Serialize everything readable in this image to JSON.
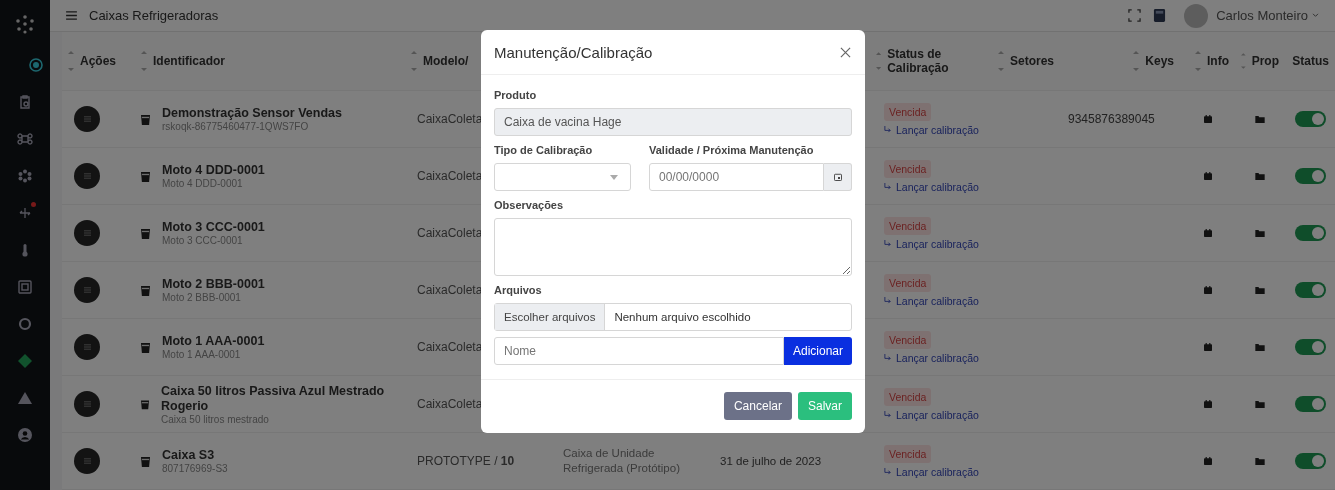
{
  "sidebar": {
    "items": [
      {
        "selected": true,
        "alert": false
      },
      {
        "selected": false,
        "alert": false
      },
      {
        "selected": false,
        "alert": false
      },
      {
        "selected": false,
        "alert": false
      },
      {
        "selected": false,
        "alert": true
      },
      {
        "selected": false,
        "alert": false
      },
      {
        "selected": false,
        "alert": false
      },
      {
        "selected": false,
        "alert": false
      },
      {
        "selected": false,
        "alert": false
      },
      {
        "selected": false,
        "alert": false
      },
      {
        "selected": false,
        "alert": false
      }
    ]
  },
  "topbar": {
    "title": "Caixas Refrigeradoras",
    "user": "Carlos Monteiro"
  },
  "table": {
    "columns": [
      {
        "label": "Ações"
      },
      {
        "label": "Identificador"
      },
      {
        "label": "Modelo/"
      },
      {},
      {},
      {
        "label": "Status de Calibração"
      },
      {
        "label": "Setores"
      },
      {
        "label": "Keys"
      },
      {
        "label": "Info"
      },
      {
        "label": "Prop"
      },
      {
        "label": "Status"
      }
    ],
    "rows": [
      {
        "name": "Demonstração Sensor Vendas",
        "code": "rskoqk-86775460477-1QWS7FO",
        "model": "CaixaColeta",
        "calibration": "Vencida",
        "action": "Lançar calibração",
        "keys": "9345876389045",
        "on": true
      },
      {
        "name": "Moto 4 DDD-0001",
        "code": "Moto 4 DDD-0001",
        "model": "CaixaColeta",
        "calibration": "Vencida",
        "action": "Lançar calibração",
        "on": true
      },
      {
        "name": "Moto 3 CCC-0001",
        "code": "Moto 3 CCC-0001",
        "model": "CaixaColeta",
        "calibration": "Vencida",
        "action": "Lançar calibração",
        "on": true
      },
      {
        "name": "Moto 2 BBB-0001",
        "code": "Moto 2 BBB-0001",
        "model": "CaixaColeta",
        "calibration": "Vencida",
        "action": "Lançar calibração",
        "on": true
      },
      {
        "name": "Moto 1 AAA-0001",
        "code": "Moto 1 AAA-0001",
        "model": "CaixaColeta",
        "calibration": "Vencida",
        "action": "Lançar calibração",
        "on": true
      },
      {
        "name": "Caixa 50 litros Passiva Azul Mestrado Rogerio",
        "code": "Caixa 50 litros mestrado",
        "model": "CaixaColeta",
        "calibration": "Vencida",
        "action": "Lançar calibração",
        "on": true
      },
      {
        "name": "Caixa S3",
        "code": "807176969-S3",
        "model": "PROTOTYPE / **10**",
        "type": "Caixa de Unidade Refrigerada (Protótipo)",
        "date": "31 de julho de 2023",
        "calibration": "Vencida",
        "action": "Lançar calibração",
        "on": true
      }
    ]
  },
  "modal": {
    "title": "Manutenção/Calibração",
    "product_label": "Produto",
    "product_value": "Caixa de vacina Hage",
    "type_label": "Tipo de Calibração",
    "validity_label": "Validade / Próxima Manutenção",
    "validity_placeholder": "00/00/0000",
    "notes_label": "Observações",
    "files_label": "Arquivos",
    "file_button": "Escolher arquivos",
    "file_status": "Nenhum arquivo escolhido",
    "name_placeholder": "Nome",
    "add_button": "Adicionar",
    "cancel_button": "Cancelar",
    "save_button": "Salvar"
  }
}
